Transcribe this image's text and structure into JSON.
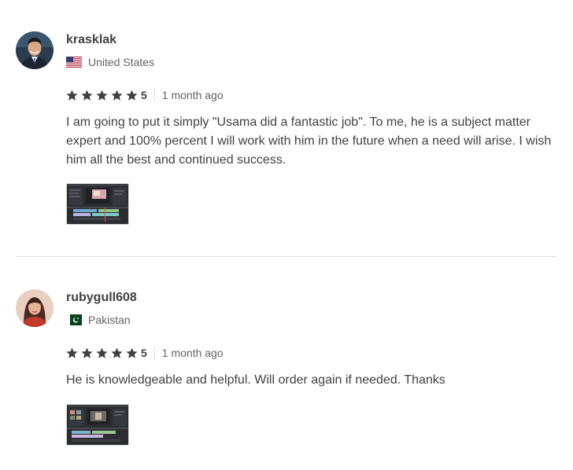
{
  "reviews": [
    {
      "username": "krasklak",
      "country": "United States",
      "flag_icon": "us-flag-icon",
      "rating": "5",
      "stars": 5,
      "time_ago": "1 month ago",
      "text": "I am going to put it simply \"Usama did a fantastic job\". To me, he is a subject matter expert and 100% percent I will work with him in the future when a need will arise. I wish him all the best and continued success."
    },
    {
      "username": "rubygull608",
      "country": "Pakistan",
      "flag_icon": "pk-flag-icon",
      "rating": "5",
      "stars": 5,
      "time_ago": "1 month ago",
      "text": "He is knowledgeable and helpful. Will order again if needed. Thanks"
    }
  ],
  "colors": {
    "text_primary": "#404145",
    "text_secondary": "#62646a",
    "divider": "#dadbdd",
    "star": "#404145"
  }
}
